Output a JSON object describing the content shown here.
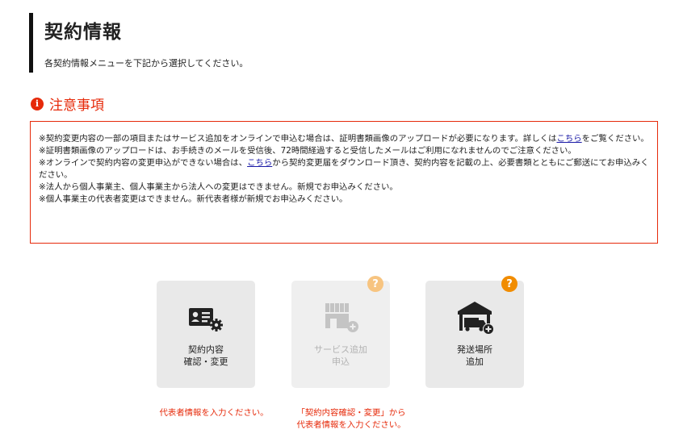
{
  "header": {
    "title": "契約情報",
    "subtitle": "各契約情報メニューを下記から選択してください。"
  },
  "notice": {
    "icon": "info-icon",
    "heading": "注意事項",
    "accent_color": "#e62a0a",
    "line1_before": "※契約変更内容の一部の項目またはサービス追加をオンラインで申込む場合は、証明書類画像のアップロードが必要になります。詳しくは",
    "line1_link": "こちら",
    "line1_after": "をご覧ください。",
    "line2": "※証明書類画像のアップロードは、お手続きのメールを受信後、72時間経過すると受信したメールはご利用になれませんのでご注意ください。",
    "line3_before": "※オンラインで契約内容の変更申込ができない場合は、",
    "line3_link": "こちら",
    "line3_after": "から契約変更届をダウンロード頂き、契約内容を記載の上、必要書類とともにご郵送にてお申込みください。",
    "line4": "※法人から個人事業主、個人事業主から法人への変更はできません。新規でお申込みください。",
    "line5": "※個人事業主の代表者変更はできません。新代表者様が新規でお申込みください。"
  },
  "menu": {
    "contract": {
      "icon": "id-card-gear-icon",
      "label_line1": "契約内容",
      "label_line2": "確認・変更"
    },
    "service": {
      "icon": "storefront-add-icon",
      "label_line1": "サービス追加",
      "label_line2": "申込",
      "help": "?",
      "disabled": true
    },
    "shipping": {
      "icon": "truck-garage-add-icon",
      "label_line1": "発送場所",
      "label_line2": "追加",
      "help": "?"
    }
  },
  "warnings": {
    "contract": "代表者情報を入力ください。",
    "service_line1": "「契約内容確認・変更」から",
    "service_line2": "代表者情報を入力ください。"
  }
}
